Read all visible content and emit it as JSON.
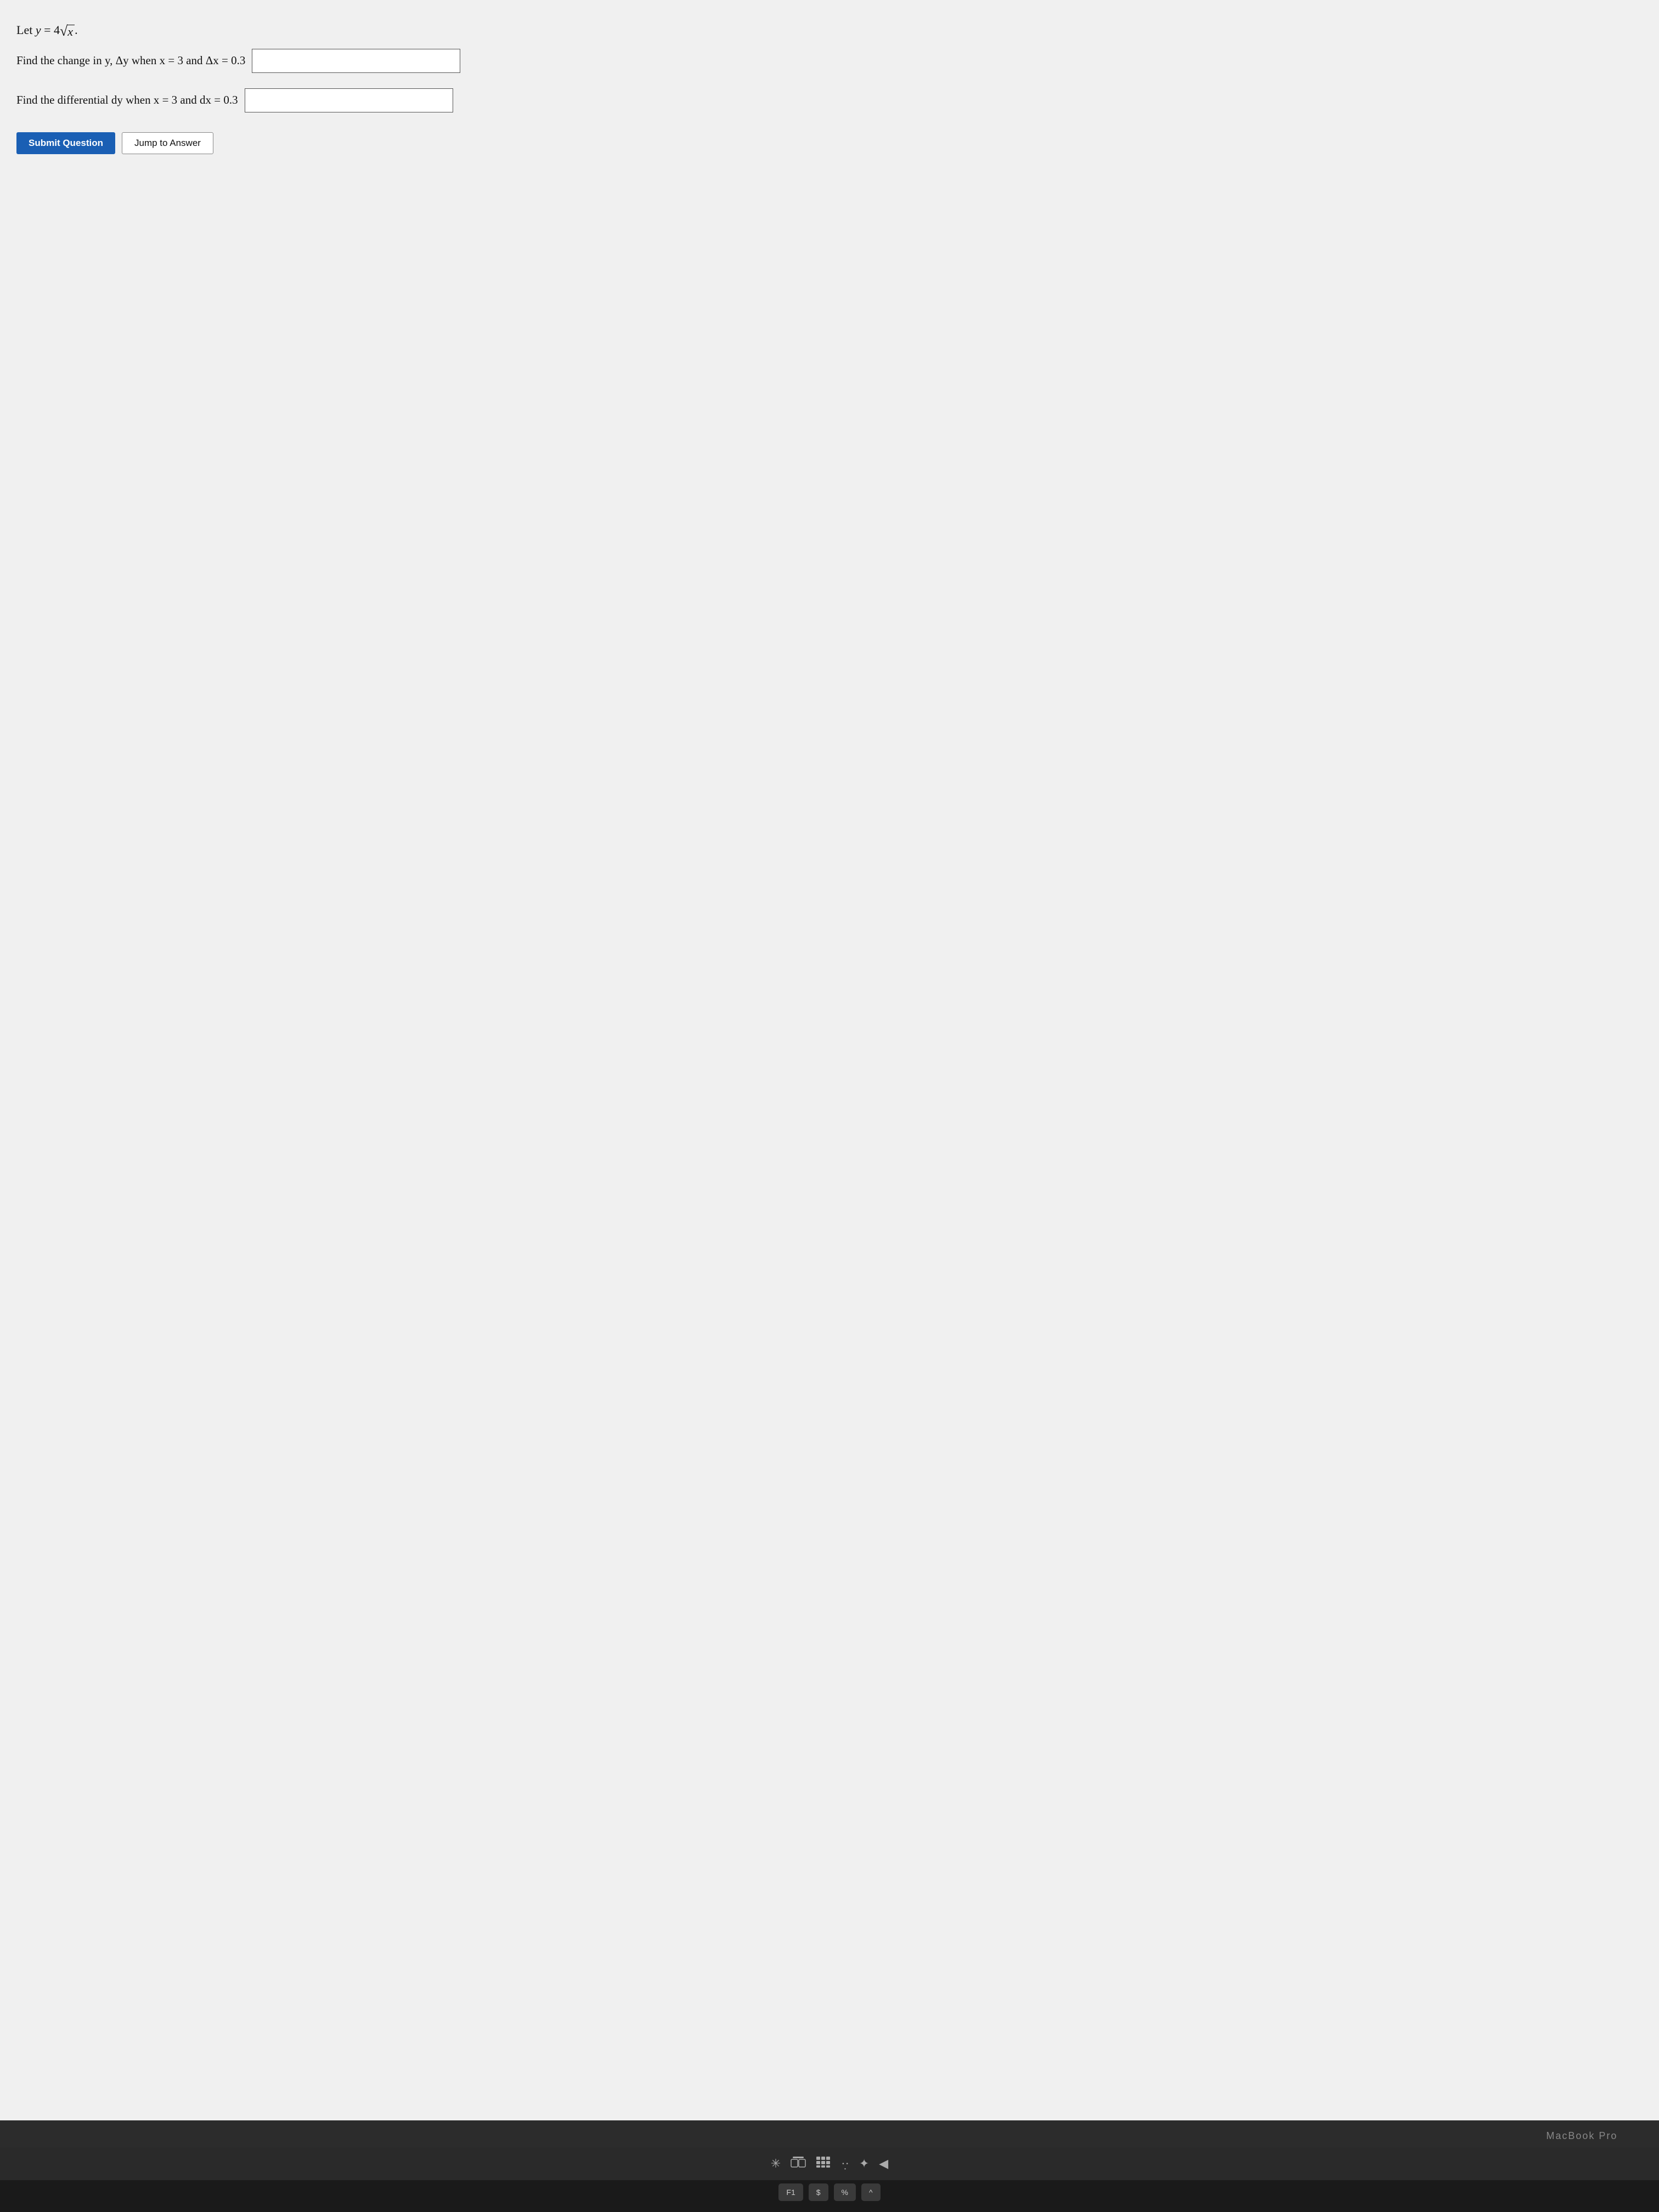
{
  "screen": {
    "background": "#f0f0f0"
  },
  "problem": {
    "definition": "Let y = 4√x.",
    "part1_prefix": "Find the change in y, Δy when x = 3 and Δx = 0.3",
    "part2_prefix": "Find the differential dy when x = 3 and dx = 0.3",
    "input1_placeholder": "",
    "input2_placeholder": ""
  },
  "buttons": {
    "submit_label": "Submit Question",
    "jump_label": "Jump to Answer"
  },
  "macbook": {
    "label": "MacBook Pro"
  }
}
